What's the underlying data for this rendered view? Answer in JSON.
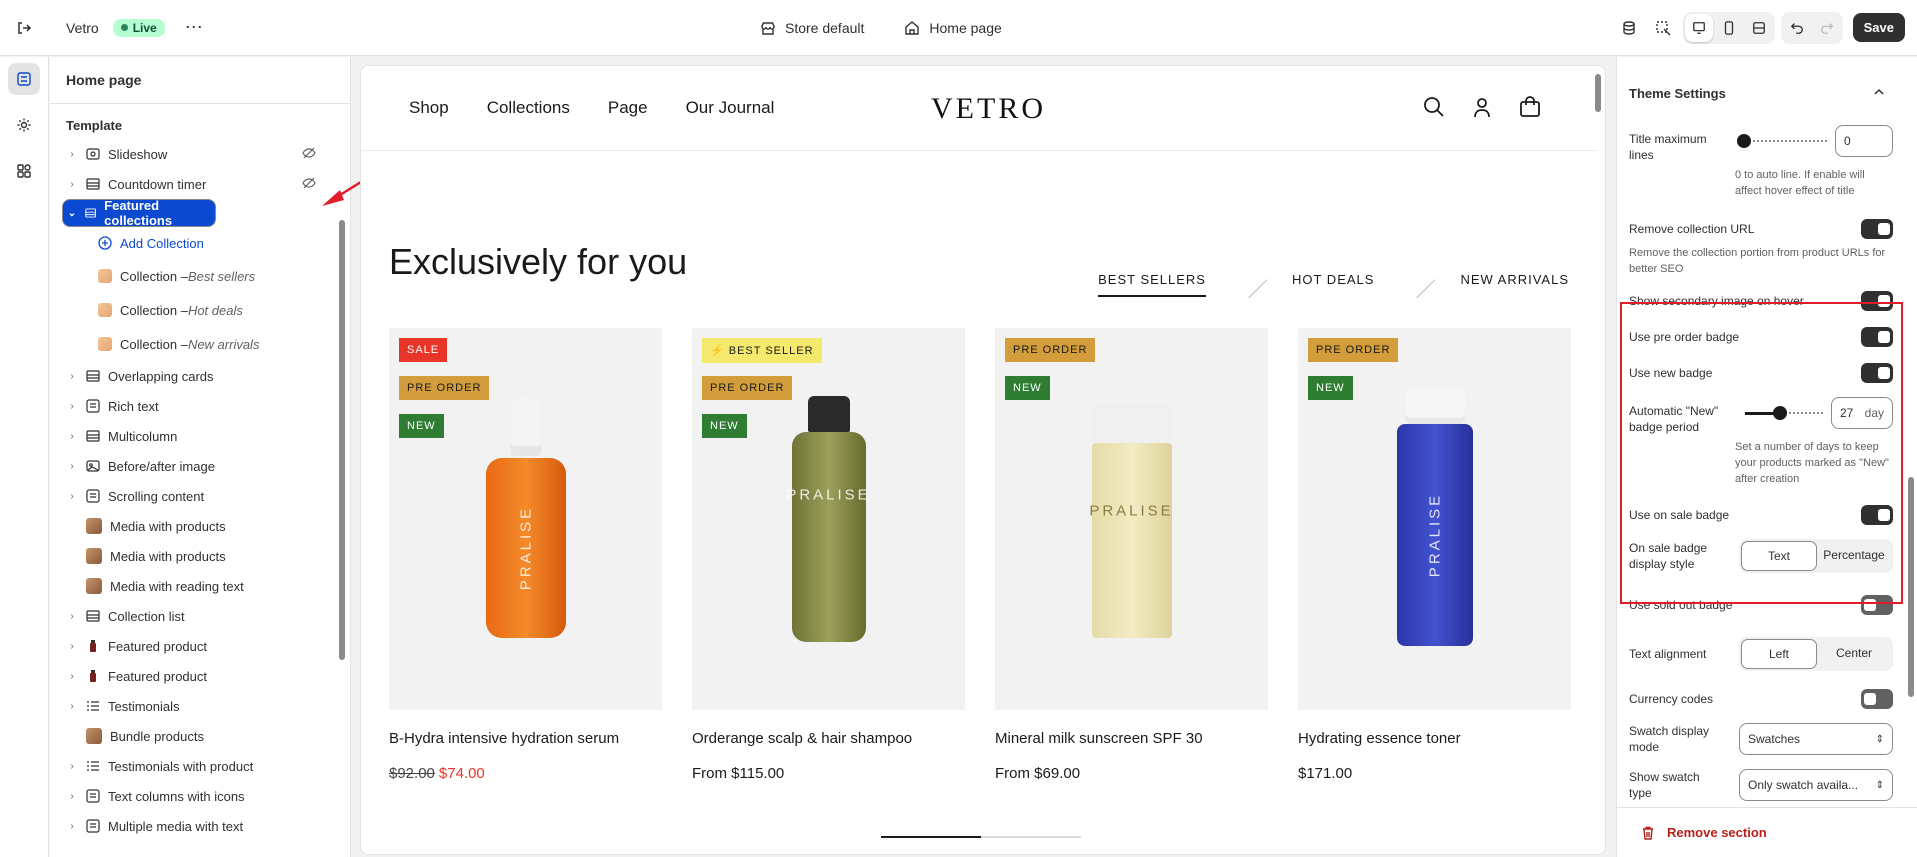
{
  "topbar": {
    "store_name": "Vetro",
    "live_label": "Live",
    "store_default": "Store default",
    "page_name": "Home page",
    "save_label": "Save"
  },
  "left_panel": {
    "title": "Home page",
    "template_label": "Template",
    "items": [
      {
        "label": "Slideshow",
        "icon": "slideshow-icon",
        "hidden": true
      },
      {
        "label": "Countdown timer",
        "icon": "section-icon",
        "hidden": true
      },
      {
        "label": "Featured collections",
        "icon": "section-icon",
        "selected": true
      }
    ],
    "add_collection": "Add Collection",
    "children": [
      {
        "prefix": "Collection – ",
        "name": "Best sellers"
      },
      {
        "prefix": "Collection – ",
        "name": "Hot deals"
      },
      {
        "prefix": "Collection – ",
        "name": "New arrivals"
      }
    ],
    "sections": [
      {
        "label": "Overlapping cards",
        "type": "section"
      },
      {
        "label": "Rich text",
        "type": "text"
      },
      {
        "label": "Multicolumn",
        "type": "section"
      },
      {
        "label": "Before/after image",
        "type": "image"
      },
      {
        "label": "Scrolling content",
        "type": "text"
      },
      {
        "label": "Media with products",
        "type": "thumb"
      },
      {
        "label": "Media with products",
        "type": "thumb"
      },
      {
        "label": "Media with reading text",
        "type": "thumb"
      },
      {
        "label": "Collection list",
        "type": "section"
      },
      {
        "label": "Featured product",
        "type": "product"
      },
      {
        "label": "Featured product",
        "type": "product"
      },
      {
        "label": "Testimonials",
        "type": "list"
      },
      {
        "label": "Bundle products",
        "type": "thumb"
      },
      {
        "label": "Testimonials with product",
        "type": "list"
      },
      {
        "label": "Text columns with icons",
        "type": "text"
      },
      {
        "label": "Multiple media with text",
        "type": "text"
      }
    ]
  },
  "canvas": {
    "nav_links": [
      "Shop",
      "Collections",
      "Page",
      "Our Journal"
    ],
    "logo": "VETRO",
    "section_title": "Exclusively for you",
    "tabs": [
      "BEST SELLERS",
      "HOT DEALS",
      "NEW ARRIVALS"
    ],
    "products": [
      {
        "name": "B-Hydra intensive hydration serum",
        "old_price": "$92.00",
        "price": "$74.00",
        "badges": [
          "SALE",
          "PRE ORDER",
          "NEW"
        ],
        "brand": "PRALISE"
      },
      {
        "name": "Orderange scalp & hair shampoo",
        "price": "From $115.00",
        "badges": [
          "⚡ BEST SELLER",
          "PRE ORDER",
          "NEW"
        ],
        "brand": "PRALISE"
      },
      {
        "name": "Mineral milk sunscreen SPF 30",
        "price": "From $69.00",
        "badges": [
          "PRE ORDER",
          "NEW"
        ],
        "brand": "PRALISE"
      },
      {
        "name": "Hydrating essence toner",
        "price": "$171.00",
        "badges": [
          "PRE ORDER",
          "NEW"
        ],
        "brand": "PRALISE"
      }
    ],
    "carousel_progress": 0.5
  },
  "right_panel": {
    "title": "Theme Settings",
    "title_max_lines_label": "Title maximum lines",
    "title_max_lines_value": "0",
    "title_max_lines_hint": "0 to auto line. If enable will affect hover effect of title",
    "remove_collection_url": "Remove collection URL",
    "remove_collection_url_hint": "Remove the collection portion from product URLs for better SEO",
    "secondary_image": "Show secondary image on hover",
    "pre_order_badge": "Use pre order badge",
    "new_badge": "Use new badge",
    "new_badge_period_label": "Automatic \"New\" badge period",
    "new_badge_period_value": "27",
    "new_badge_period_unit": "day",
    "new_badge_period_hint": "Set a number of days to keep your products marked as \"New\" after creation",
    "on_sale_badge": "Use on sale badge",
    "on_sale_style_label": "On sale badge display style",
    "on_sale_style_options": [
      "Text",
      "Percentage"
    ],
    "sold_out_badge": "Use sold out badge",
    "text_alignment_label": "Text alignment",
    "text_alignment_options": [
      "Left",
      "Center"
    ],
    "currency_codes": "Currency codes",
    "swatch_mode_label": "Swatch display mode",
    "swatch_mode_value": "Swatches",
    "swatch_type_label": "Show swatch type",
    "swatch_type_value": "Only swatch availa...",
    "remove_section": "Remove section"
  },
  "colors": {
    "accent": "#0b4ad0",
    "highlight": "#e01e2b",
    "sale": "#e8352a"
  }
}
